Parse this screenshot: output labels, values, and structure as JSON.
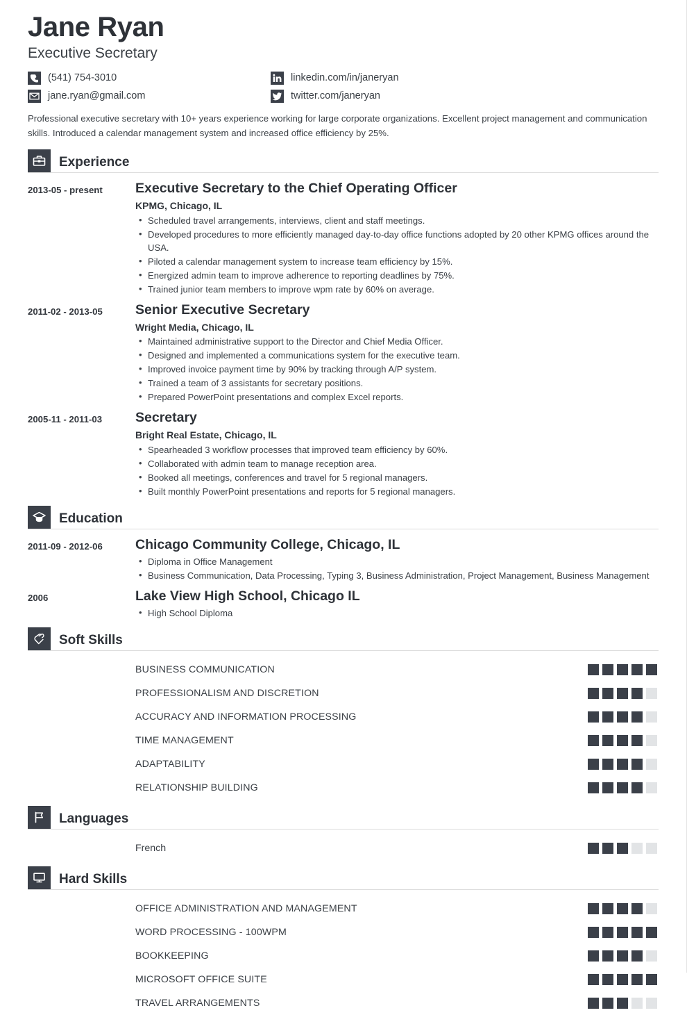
{
  "accent_color": "#3b4049",
  "header": {
    "name": "Jane Ryan",
    "job_title": "Executive Secretary",
    "contacts_left": [
      {
        "icon": "phone-icon",
        "text": "(541) 754-3010"
      },
      {
        "icon": "email-icon",
        "text": "jane.ryan@gmail.com"
      }
    ],
    "contacts_right": [
      {
        "icon": "linkedin-icon",
        "text": "linkedin.com/in/janeryan"
      },
      {
        "icon": "twitter-icon",
        "text": "twitter.com/janeryan"
      }
    ],
    "summary": "Professional executive secretary with 10+ years experience working for large corporate organizations. Excellent project management and communication skills. Introduced a calendar management system and increased office efficiency by 25%."
  },
  "sections": {
    "experience": {
      "title": "Experience",
      "icon": "briefcase-icon",
      "entries": [
        {
          "dates": "2013-05 - present",
          "role": "Executive Secretary to the Chief Operating Officer",
          "org": "KPMG, Chicago, IL",
          "bullets": [
            "Scheduled travel arrangements, interviews, client and staff meetings.",
            "Developed procedures to more efficiently managed day-to-day office functions adopted by 20 other KPMG offices around the USA.",
            "Piloted a calendar management system to increase team efficiency by 15%.",
            "Energized admin team to improve adherence to reporting deadlines by 75%.",
            "Trained junior team members to improve wpm rate by 60% on average."
          ]
        },
        {
          "dates": "2011-02 - 2013-05",
          "role": "Senior Executive Secretary",
          "org": "Wright Media, Chicago, IL",
          "bullets": [
            "Maintained administrative support to the Director and Chief Media Officer.",
            "Designed and implemented a communications system for the executive team.",
            "Improved invoice payment time by 90% by tracking through A/P system.",
            "Trained a team of 3 assistants for secretary positions.",
            "Prepared PowerPoint presentations and complex Excel reports."
          ]
        },
        {
          "dates": "2005-11 - 2011-03",
          "role": "Secretary",
          "org": "Bright Real Estate, Chicago, IL",
          "bullets": [
            "Spearheaded 3 workflow processes that improved team efficiency by 60%.",
            "Collaborated with admin team to manage reception area.",
            "Booked all meetings, conferences and travel for 5 regional managers.",
            "Built monthly PowerPoint presentations and reports for 5 regional managers."
          ]
        }
      ]
    },
    "education": {
      "title": "Education",
      "icon": "graduation-cap-icon",
      "entries": [
        {
          "dates": "2011-09 - 2012-06",
          "role": "Chicago Community College, Chicago, IL",
          "org": "",
          "bullets": [
            "Diploma in Office Management",
            "Business Communication, Data Processing, Typing 3, Business Administration, Project Management, Business Management"
          ]
        },
        {
          "dates": "2006",
          "role": "Lake View High School, Chicago IL",
          "org": "",
          "bullets": [
            "High School Diploma"
          ]
        }
      ]
    },
    "soft_skills": {
      "title": "Soft Skills",
      "icon": "heart-hand-icon",
      "max_rating": 5,
      "items": [
        {
          "label": "BUSINESS COMMUNICATION",
          "rating": 5
        },
        {
          "label": "PROFESSIONALISM AND DISCRETION",
          "rating": 4
        },
        {
          "label": "ACCURACY AND INFORMATION PROCESSING",
          "rating": 4
        },
        {
          "label": "TIME MANAGEMENT",
          "rating": 4
        },
        {
          "label": "ADAPTABILITY",
          "rating": 4
        },
        {
          "label": "RELATIONSHIP BUILDING",
          "rating": 4
        }
      ]
    },
    "languages": {
      "title": "Languages",
      "icon": "flag-icon",
      "max_rating": 5,
      "items": [
        {
          "label": "French",
          "rating": 3
        }
      ]
    },
    "hard_skills": {
      "title": "Hard Skills",
      "icon": "monitor-icon",
      "max_rating": 5,
      "items": [
        {
          "label": "OFFICE ADMINISTRATION AND MANAGEMENT",
          "rating": 4
        },
        {
          "label": "WORD PROCESSING - 100WPM",
          "rating": 5
        },
        {
          "label": "BOOKKEEPING",
          "rating": 4
        },
        {
          "label": "MICROSOFT OFFICE SUITE",
          "rating": 5
        },
        {
          "label": "TRAVEL ARRANGEMENTS",
          "rating": 3
        }
      ]
    }
  }
}
